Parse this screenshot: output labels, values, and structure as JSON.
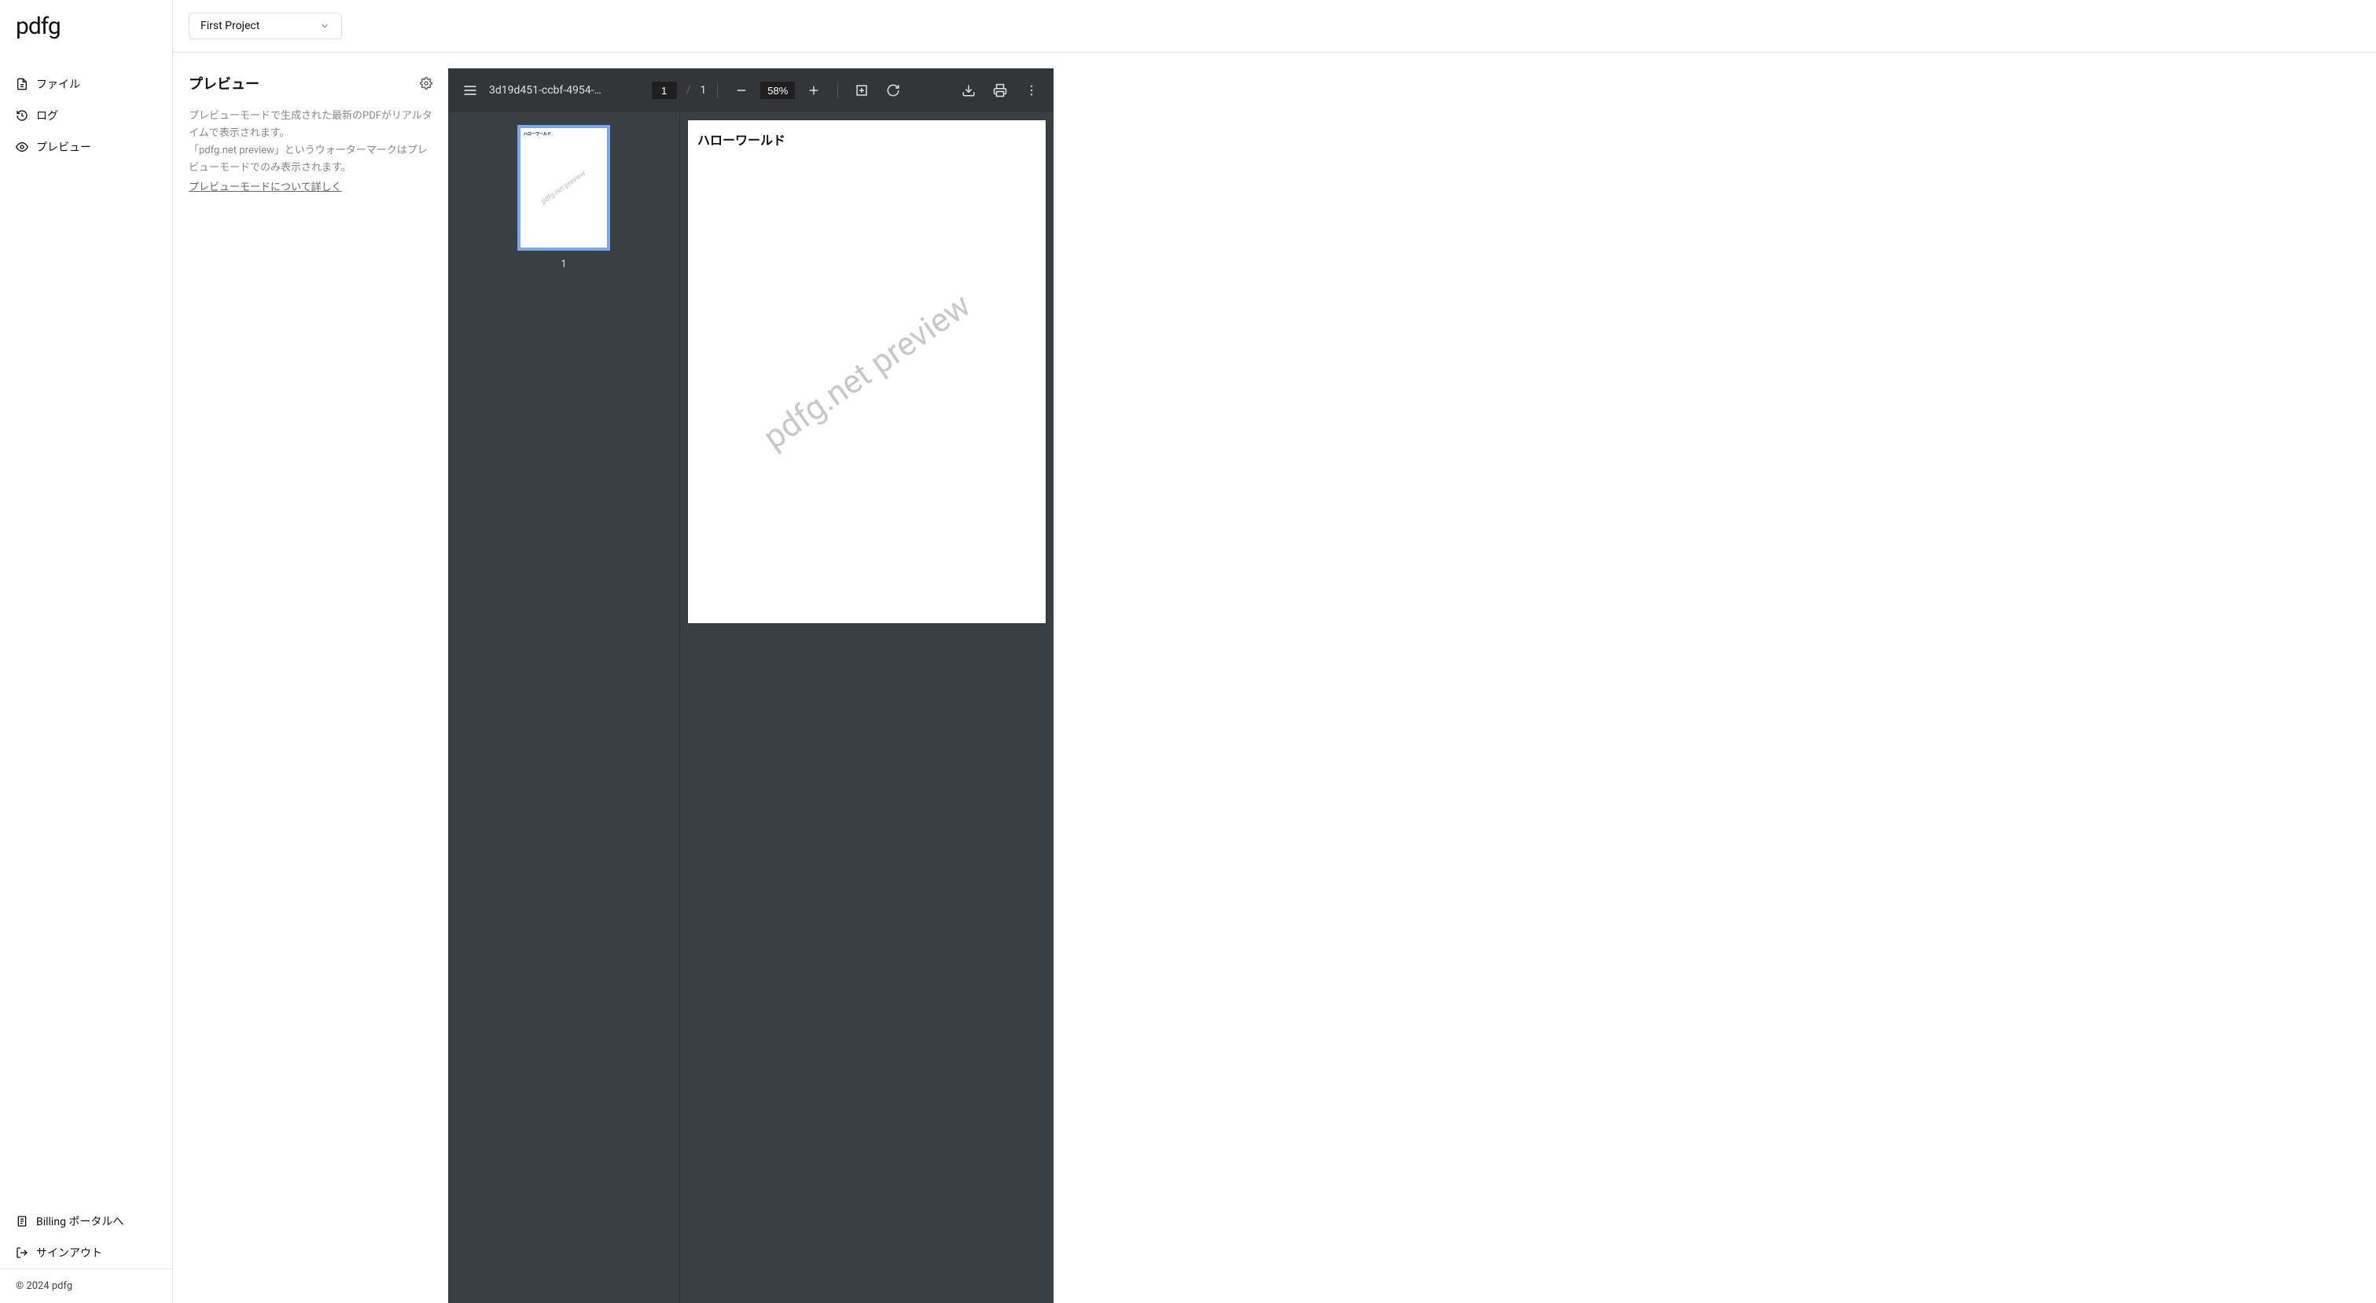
{
  "logo": "pdfg",
  "sidebar": {
    "items": [
      {
        "label": "ファイル"
      },
      {
        "label": "ログ"
      },
      {
        "label": "プレビュー"
      }
    ],
    "bottom": [
      {
        "label": "Billing ポータルへ"
      },
      {
        "label": "サインアウト"
      }
    ]
  },
  "footer": "© 2024 pdfg",
  "project_select": "First Project",
  "info": {
    "title": "プレビュー",
    "desc1": "プレビューモードで生成された最新のPDFがリアルタイムで表示されます。",
    "desc2": "「pdfg.net preview」というウォーターマークはプレビューモードでのみ表示されます。",
    "link": "プレビューモードについて詳しく"
  },
  "pdf": {
    "filename": "3d19d451-ccbf-4954-…",
    "page_current": "1",
    "page_sep": "/",
    "page_total": "1",
    "zoom": "58%",
    "thumb_num": "1",
    "content_heading": "ハローワールド",
    "watermark": "pdfg.net preview"
  }
}
